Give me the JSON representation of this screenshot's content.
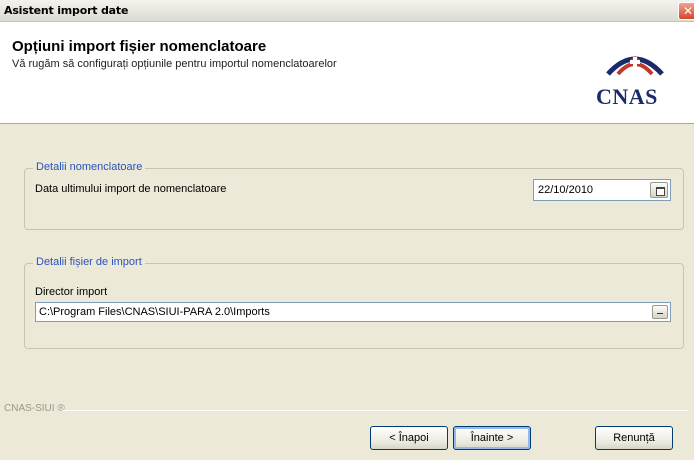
{
  "window": {
    "title": "Asistent import date",
    "close_icon": "close-icon"
  },
  "header": {
    "title": "Opțiuni import fișier nomenclatoare",
    "subtitle": "Vă rugăm să configurați opțiunile pentru importul nomenclatoarelor",
    "logo_text": "CNAS",
    "logo_colors": {
      "red": "#c0392b",
      "blue": "#1b2a6b"
    }
  },
  "groups": {
    "nomenclatoare": {
      "legend": "Detalii nomenclatoare",
      "date_label": "Data ultimului import de nomenclatoare",
      "date_value": "22/10/2010",
      "calendar_icon": "calendar-icon"
    },
    "import_file": {
      "legend": "Detalii fișier de import",
      "dir_label": "Director import",
      "dir_value": "C:\\Program Files\\CNAS\\SIUI-PARA 2.0\\Imports",
      "browse_icon": "browse-icon"
    }
  },
  "footer": {
    "brand": "CNAS-SIUI ®"
  },
  "buttons": {
    "back": "< Înapoi",
    "next": "Înainte >",
    "cancel": "Renunță"
  },
  "colors": {
    "legend": "#2a52be",
    "window_bg": "#ece9d8",
    "header_bg": "#ffffff"
  }
}
